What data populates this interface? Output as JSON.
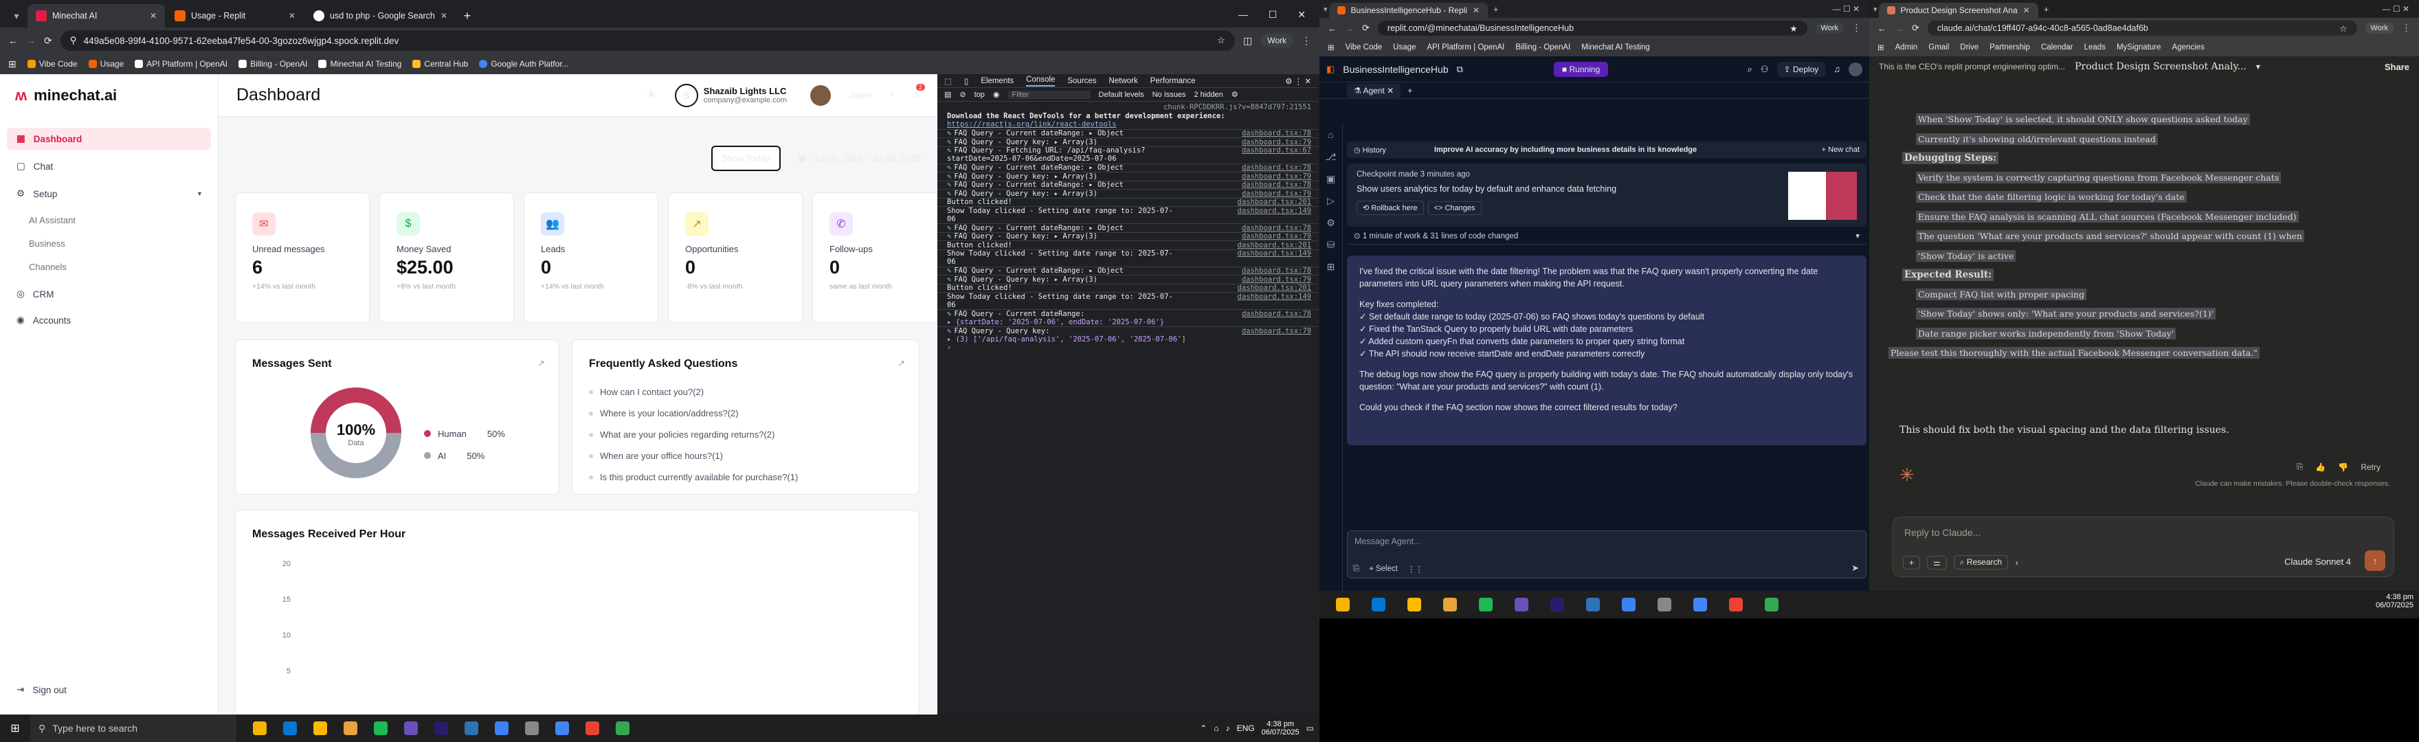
{
  "w1": {
    "tabs": [
      {
        "label": "Minechat AI",
        "active": true
      },
      {
        "label": "Usage - Replit",
        "active": false
      },
      {
        "label": "usd to php - Google Search",
        "active": false
      }
    ],
    "url": "449a5e08-99f4-4100-9571-62eeba47fe54-00-3gozoz6wjgp4.spock.replit.dev",
    "profile": "Work",
    "bookmarks": [
      "Vibe Code",
      "Usage",
      "API Platform | OpenAI",
      "Billing - OpenAI",
      "Minechat AI Testing",
      "Central Hub",
      "Google Auth Platfor..."
    ],
    "app": {
      "logo": "minechat.ai",
      "nav": [
        {
          "label": "Dashboard",
          "active": true
        },
        {
          "label": "Chat"
        },
        {
          "label": "Setup"
        }
      ],
      "subnav": [
        "AI Assistant",
        "Business",
        "Channels"
      ],
      "nav2": [
        "CRM",
        "Accounts"
      ],
      "signout": "Sign out",
      "title": "Dashboard",
      "company": "Shazaib Lights LLC",
      "email": "company@example.com",
      "user": "Jayce",
      "notif": "2",
      "show_today": "Show Today",
      "date_range": "Jul 06, 2025 – Jul 06, 2025",
      "stats": [
        {
          "label": "Unread messages",
          "value": "6",
          "sub": "+14% vs last month",
          "color": "#ef4444",
          "bg": "#fee2e2",
          "icon": "✉"
        },
        {
          "label": "Money Saved",
          "value": "$25.00",
          "sub": "+8% vs last month",
          "color": "#16a34a",
          "bg": "#dcfce7",
          "icon": "$"
        },
        {
          "label": "Leads",
          "value": "0",
          "sub": "+14% vs last month",
          "color": "#2563eb",
          "bg": "#dbeafe",
          "icon": "👥"
        },
        {
          "label": "Opportunities",
          "value": "0",
          "sub": "-8% vs last month",
          "color": "#ca8a04",
          "bg": "#fef9c3",
          "icon": "↗"
        },
        {
          "label": "Follow-ups",
          "value": "0",
          "sub": "same as last month",
          "color": "#9333ea",
          "bg": "#f3e8ff",
          "icon": "✆"
        }
      ],
      "messages_sent": {
        "title": "Messages Sent",
        "center_value": "100%",
        "center_label": "Data",
        "legend": [
          {
            "name": "Human",
            "pct": "50%",
            "color": "#c0395a"
          },
          {
            "name": "AI",
            "pct": "50%",
            "color": "#9ca3af"
          }
        ]
      },
      "faq": {
        "title": "Frequently Asked Questions",
        "items": [
          "How can I contact you?(2)",
          "Where is your location/address?(2)",
          "What are your policies regarding returns?(2)",
          "When are your office hours?(1)",
          "Is this product currently available for purchase?(1)"
        ]
      },
      "per_hour": {
        "title": "Messages Received Per Hour",
        "yticks": [
          "20",
          "15",
          "10",
          "5"
        ]
      }
    },
    "devtools": {
      "tabs": [
        "Elements",
        "Console",
        "Sources",
        "Network",
        "Performance"
      ],
      "top": "top",
      "filter": "Filter",
      "levels": "Default levels",
      "issues": "No Issues",
      "hidden": "2 hidden",
      "lines": [
        {
          "t": "chunk-RPCDDKRR.js?v=8847d797:21551",
          "src": "",
          "k": "src"
        },
        {
          "t": "Download the React DevTools for a better development experience:",
          "src": "",
          "k": "b"
        },
        {
          "t": "https://reactjs.org/link/react-devtools",
          "src": "",
          "k": "link"
        },
        {
          "t": "FAQ Query - Current dateRange:  ▸ Object",
          "src": "dashboard.tsx:78",
          "k": "q"
        },
        {
          "t": "FAQ Query - Query key:  ▸ Array(3)",
          "src": "dashboard.tsx:79",
          "k": "q"
        },
        {
          "t": "FAQ Query - Fetching URL: /api/faq-analysis?",
          "src": "dashboard.tsx:67",
          "k": "q"
        },
        {
          "t": "startDate=2025-07-06&endDate=2025-07-06",
          "src": "",
          "k": "c"
        },
        {
          "t": "FAQ Query - Current dateRange:  ▸ Object",
          "src": "dashboard.tsx:78",
          "k": "q"
        },
        {
          "t": "FAQ Query - Query key:  ▸ Array(3)",
          "src": "dashboard.tsx:79",
          "k": "q"
        },
        {
          "t": "FAQ Query - Current dateRange:  ▸ Object",
          "src": "dashboard.tsx:78",
          "k": "q"
        },
        {
          "t": "FAQ Query - Query key:  ▸ Array(3)",
          "src": "dashboard.tsx:79",
          "k": "q"
        },
        {
          "t": "Button clicked!",
          "src": "dashboard.tsx:201",
          "k": "p"
        },
        {
          "t": "Show Today clicked - Setting date range to: 2025-07-",
          "src": "dashboard.tsx:149",
          "k": "p"
        },
        {
          "t": "06",
          "src": "",
          "k": "c"
        },
        {
          "t": "FAQ Query - Current dateRange:  ▸ Object",
          "src": "dashboard.tsx:78",
          "k": "q"
        },
        {
          "t": "FAQ Query - Query key:  ▸ Array(3)",
          "src": "dashboard.tsx:79",
          "k": "q"
        },
        {
          "t": "Button clicked!",
          "src": "dashboard.tsx:201",
          "k": "p"
        },
        {
          "t": "Show Today clicked - Setting date range to: 2025-07-",
          "src": "dashboard.tsx:149",
          "k": "p"
        },
        {
          "t": "06",
          "src": "",
          "k": "c"
        },
        {
          "t": "FAQ Query - Current dateRange:  ▸ Object",
          "src": "dashboard.tsx:78",
          "k": "q"
        },
        {
          "t": "FAQ Query - Query key:  ▸ Array(3)",
          "src": "dashboard.tsx:79",
          "k": "q"
        },
        {
          "t": "Button clicked!",
          "src": "dashboard.tsx:201",
          "k": "p"
        },
        {
          "t": "Show Today clicked - Setting date range to: 2025-07-",
          "src": "dashboard.tsx:149",
          "k": "p"
        },
        {
          "t": "06",
          "src": "",
          "k": "c"
        },
        {
          "t": "FAQ Query - Current dateRange:",
          "src": "dashboard.tsx:78",
          "k": "q"
        },
        {
          "t": "  ▸ {startDate: '2025-07-06', endDate: '2025-07-06'}",
          "src": "",
          "k": "obj"
        },
        {
          "t": "FAQ Query - Query key:",
          "src": "dashboard.tsx:79",
          "k": "q"
        },
        {
          "t": "  ▸ (3) ['/api/faq-analysis', '2025-07-06', '2025-07-06']",
          "src": "",
          "k": "obj"
        }
      ]
    }
  },
  "w2": {
    "tabs": [
      {
        "label": "BusinessIntelligenceHub - Repli",
        "active": true
      }
    ],
    "url": "replit.com/@minechatai/BusinessIntelligenceHub",
    "profile": "Work",
    "bookmarks": [
      "Vibe Code",
      "Usage",
      "API Platform | OpenAI",
      "Billing - OpenAI",
      "Minechat AI Testing"
    ],
    "project": "BusinessIntelligenceHub",
    "running": "Running",
    "deploy": "Deploy",
    "agent_tab": "Agent",
    "history": "History",
    "suggestion": "Improve AI accuracy by including more business details in its knowledge",
    "new_chat": "New chat",
    "checkpoint_time": "Checkpoint made 3 minutes ago",
    "checkpoint_title": "Show users analytics for today by default and enhance data fetching",
    "rollback": "Rollback here",
    "changes": "Changes",
    "work_summary": "1 minute of work & 31 lines of code changed",
    "msg": {
      "p1": "I've fixed the critical issue with the date filtering! The problem was that the FAQ query wasn't properly converting the date parameters into URL query parameters when making the API request.",
      "fixes_title": "Key fixes completed:",
      "fixes": [
        "✓ Set default date range to today (2025-07-06) so FAQ shows today's questions by default",
        "✓ Fixed the TanStack Query to properly build URL with date parameters",
        "✓ Added custom queryFn that converts date parameters to proper query string format",
        "✓ The API should now receive startDate and endDate parameters correctly"
      ],
      "p2": "The debug logs now show the FAQ query is properly building with today's date. The FAQ should automatically display only today's question: \"What are your products and services?\" with count (1).",
      "p3": "Could you check if the FAQ section now shows the correct filtered results for today?"
    },
    "input_placeholder": "Message Agent...",
    "select": "Select"
  },
  "w3": {
    "tabs": [
      {
        "label": "Product Design Screenshot Ana",
        "active": true
      }
    ],
    "url": "claude.ai/chat/c19ff407-a94c-40c8-a565-0ad8ae4daf6b",
    "profile": "Work",
    "bookmarks": [
      "Admin",
      "Gmail",
      "Drive",
      "Partnership",
      "Calendar",
      "Leads",
      "MySignature",
      "Agencies"
    ],
    "header_left": "This is the CEO's replit prompt engineering optim...",
    "title": "Product Design Screenshot Analy...",
    "share": "Share",
    "content": [
      {
        "k": "hl",
        "t": "When 'Show Today' is selected, it should ONLY show questions asked today"
      },
      {
        "k": "hl",
        "t": "Currently it's showing old/irrelevant questions instead"
      },
      {
        "k": "h",
        "t": "Debugging Steps:"
      },
      {
        "k": "hl",
        "t": "Verify the system is correctly capturing questions from Facebook Messenger chats"
      },
      {
        "k": "hl",
        "t": "Check that the date filtering logic is working for today's date"
      },
      {
        "k": "hl",
        "t": "Ensure the FAQ analysis is scanning ALL chat sources (Facebook Messenger included)"
      },
      {
        "k": "hl",
        "t": "The question 'What are your products and services?' should appear with count (1) when"
      },
      {
        "k": "hl",
        "t": "'Show Today' is active"
      },
      {
        "k": "h",
        "t": "Expected Result:"
      },
      {
        "k": "hl",
        "t": "Compact FAQ list with proper spacing"
      },
      {
        "k": "hl",
        "t": "'Show Today' shows only: 'What are your products and services?(1)'"
      },
      {
        "k": "hl",
        "t": "Date range picker works independently from 'Show Today'"
      },
      {
        "k": "hlp",
        "t": "Please test this thoroughly with the actual Facebook Messenger conversation data.\""
      }
    ],
    "final": "This should fix both the visual spacing and the data filtering issues.",
    "retry": "Retry",
    "disclaimer": "Claude can make mistakes. Please double-check responses.",
    "reply_placeholder": "Reply to Claude...",
    "research": "Research",
    "model": "Claude Sonnet 4"
  },
  "taskbar": {
    "search": "Type here to search",
    "time": "4:38 pm",
    "date": "06/07/2025",
    "lang": "ENG"
  }
}
